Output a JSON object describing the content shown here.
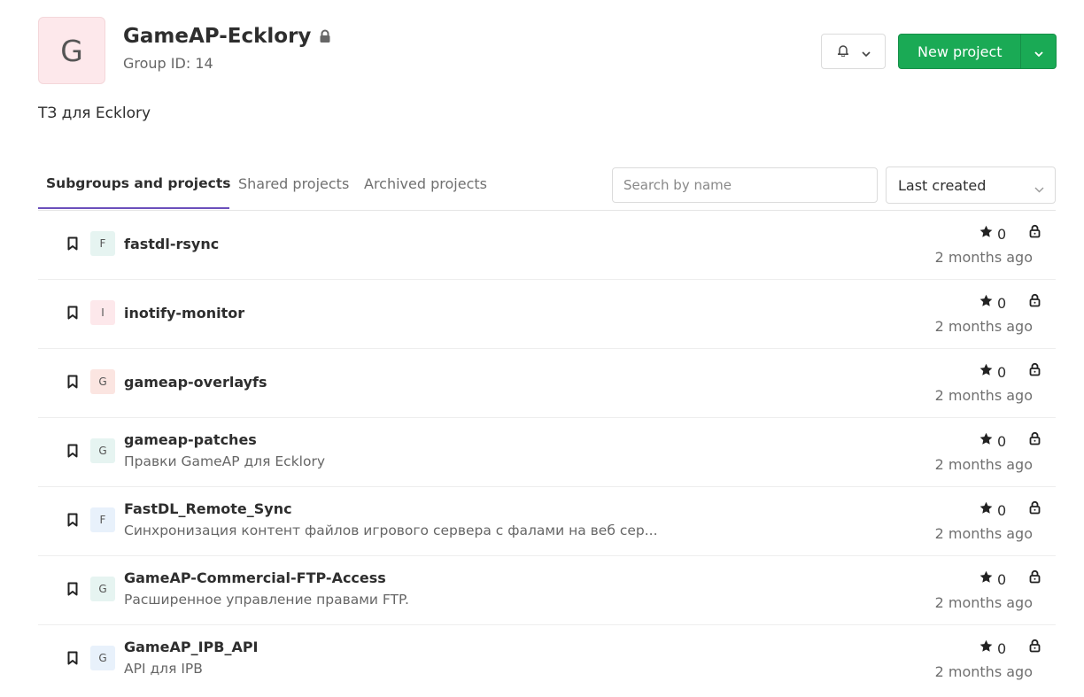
{
  "group": {
    "avatar_letter": "G",
    "name": "GameAP-Ecklory",
    "id_text": "Group ID: 14",
    "description": "ТЗ для Ecklory"
  },
  "header": {
    "new_project_label": "New project"
  },
  "tabs": [
    {
      "label": "Subgroups and projects",
      "active": true
    },
    {
      "label": "Shared projects",
      "active": false
    },
    {
      "label": "Archived projects",
      "active": false
    }
  ],
  "search": {
    "placeholder": "Search by name",
    "value": ""
  },
  "sort": {
    "selected": "Last created"
  },
  "projects": [
    {
      "letter": "F",
      "name": "fastdl-rsync",
      "description": "",
      "stars": "0",
      "updated": "2 months ago",
      "avatar_color": "#e6f4f1"
    },
    {
      "letter": "I",
      "name": "inotify-monitor",
      "description": "",
      "stars": "0",
      "updated": "2 months ago",
      "avatar_color": "#fde8eb"
    },
    {
      "letter": "G",
      "name": "gameap-overlayfs",
      "description": "",
      "stars": "0",
      "updated": "2 months ago",
      "avatar_color": "#fbe5e1"
    },
    {
      "letter": "G",
      "name": "gameap-patches",
      "description": "Правки GameAP для Ecklory",
      "stars": "0",
      "updated": "2 months ago",
      "avatar_color": "#e6f4f1"
    },
    {
      "letter": "F",
      "name": "FastDL_Remote_Sync",
      "description": "Синхронизация контент файлов игрового сервера с фалами на веб сер...",
      "stars": "0",
      "updated": "2 months ago",
      "avatar_color": "#e8f1fb"
    },
    {
      "letter": "G",
      "name": "GameAP-Commercial-FTP-Access",
      "description": "Расширенное управление правами FTP.",
      "stars": "0",
      "updated": "2 months ago",
      "avatar_color": "#e6f4f1"
    },
    {
      "letter": "G",
      "name": "GameAP_IPB_API",
      "description": "API для IPB",
      "stars": "0",
      "updated": "2 months ago",
      "avatar_color": "#e8f1fb"
    }
  ],
  "icons": {
    "title_lock": "lock-icon",
    "notification": "bell-icon",
    "dropdown": "chevron-down-icon",
    "bookmark": "bookmark-icon",
    "star": "star-icon",
    "visibility": "lock-icon"
  },
  "colors": {
    "primary_button": "#1aaa55",
    "tab_underline": "#6b4fbb"
  }
}
